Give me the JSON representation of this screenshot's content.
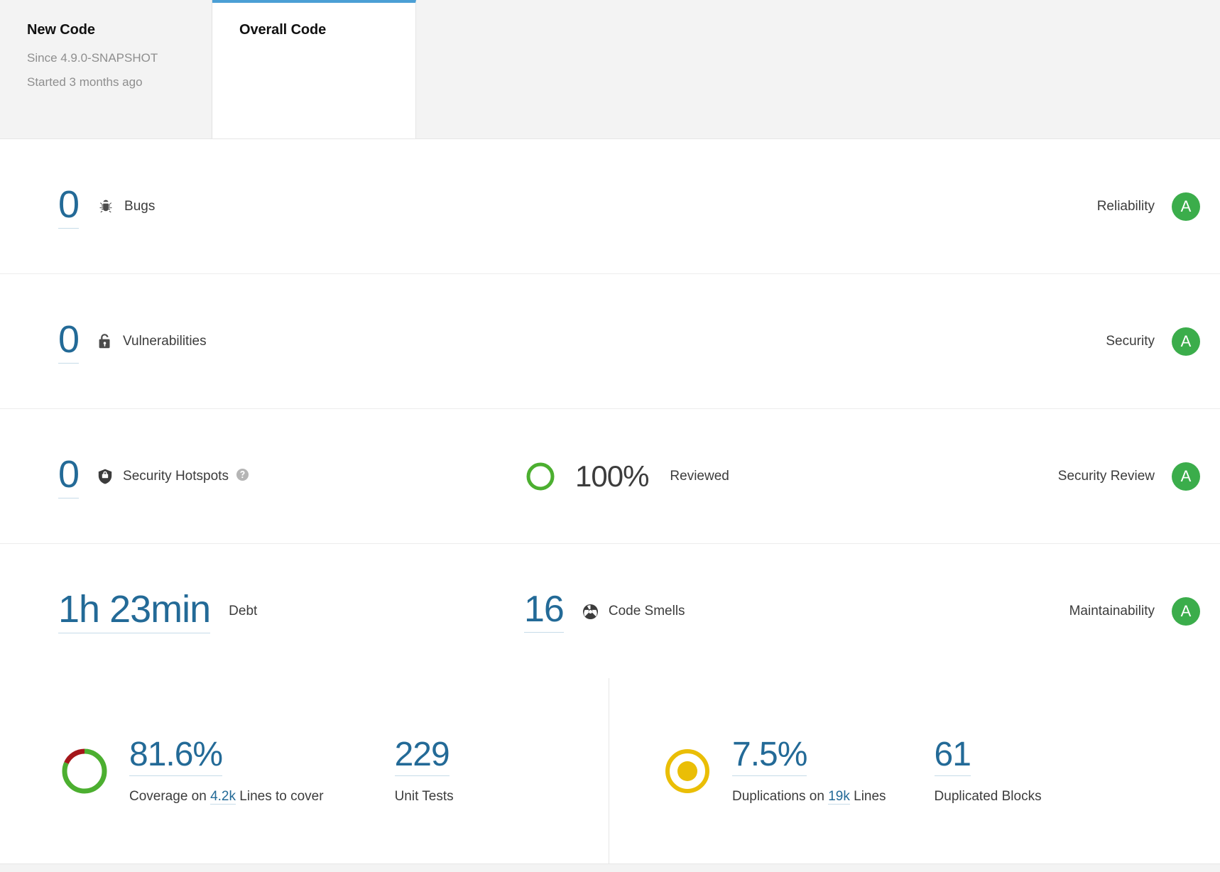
{
  "tabs": [
    {
      "label": "New Code",
      "sub": "Since 4.9.0-SNAPSHOT",
      "sub2": "Started 3 months ago",
      "active": false
    },
    {
      "label": "Overall Code",
      "active": true
    }
  ],
  "colors": {
    "accent": "#4b9fd5",
    "link": "#236a97",
    "rating_a": "#3bad4b",
    "coverage_good": "#4caf30",
    "coverage_bad": "#a4161a",
    "duplication": "#eabe06",
    "text": "#3c3c3c",
    "muted": "#8e8e8e"
  },
  "measures": [
    {
      "value": "0",
      "icon": "bug-icon",
      "label": "Bugs",
      "rating_label": "Reliability",
      "rating": "A"
    },
    {
      "value": "0",
      "icon": "vulnerability-lock-icon",
      "label": "Vulnerabilities",
      "rating_label": "Security",
      "rating": "A"
    },
    {
      "value": "0",
      "icon": "security-hotspot-shield-icon",
      "label": "Security Hotspots",
      "help": "help-icon",
      "secondary_value": "100%",
      "secondary_label": "Reviewed",
      "secondary_percent": 100,
      "rating_label": "Security Review",
      "rating": "A"
    },
    {
      "value": "1h 23min",
      "label": "Debt",
      "secondary_value": "16",
      "icon2": "code-smell-icon",
      "secondary_label": "Code Smells",
      "rating_label": "Maintainability",
      "rating": "A"
    }
  ],
  "bottom": {
    "coverage": {
      "value": "81.6%",
      "percent": 81.6,
      "caption_before": "Coverage on ",
      "caption_link": "4.2k",
      "caption_after": " Lines to cover"
    },
    "unit_tests": {
      "value": "229",
      "caption": "Unit Tests"
    },
    "duplications": {
      "value": "7.5%",
      "percent": 7.5,
      "caption_before": "Duplications on ",
      "caption_link": "19k",
      "caption_after": " Lines"
    },
    "duplicated_blocks": {
      "value": "61",
      "caption": "Duplicated Blocks"
    }
  }
}
